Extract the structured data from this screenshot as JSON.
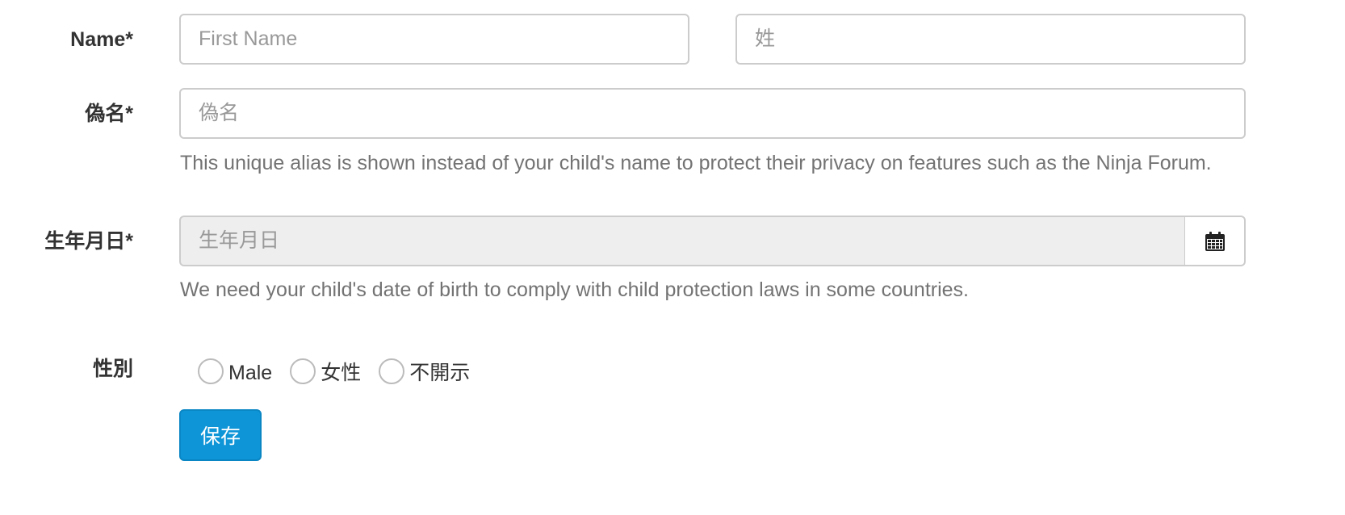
{
  "form": {
    "name": {
      "label": "Name*",
      "first_placeholder": "First Name",
      "first_value": "",
      "last_placeholder": "姓",
      "last_value": ""
    },
    "alias": {
      "label": "偽名*",
      "placeholder": "偽名",
      "value": "",
      "help": "This unique alias is shown instead of your child's name to protect their privacy on features such as the Ninja Forum."
    },
    "birthday": {
      "label": "生年月日*",
      "placeholder": "生年月日",
      "value": "",
      "help": "We need your child's date of birth to comply with child protection laws in some countries.",
      "icon": "calendar-icon"
    },
    "gender": {
      "label": "性別",
      "options": [
        {
          "label": "Male",
          "checked": false
        },
        {
          "label": "女性",
          "checked": false
        },
        {
          "label": "不開示",
          "checked": false
        }
      ]
    },
    "save_label": "保存"
  },
  "colors": {
    "primary_button": "#0d95d8",
    "readonly_background": "#eeeeee",
    "help_text": "#737373"
  }
}
